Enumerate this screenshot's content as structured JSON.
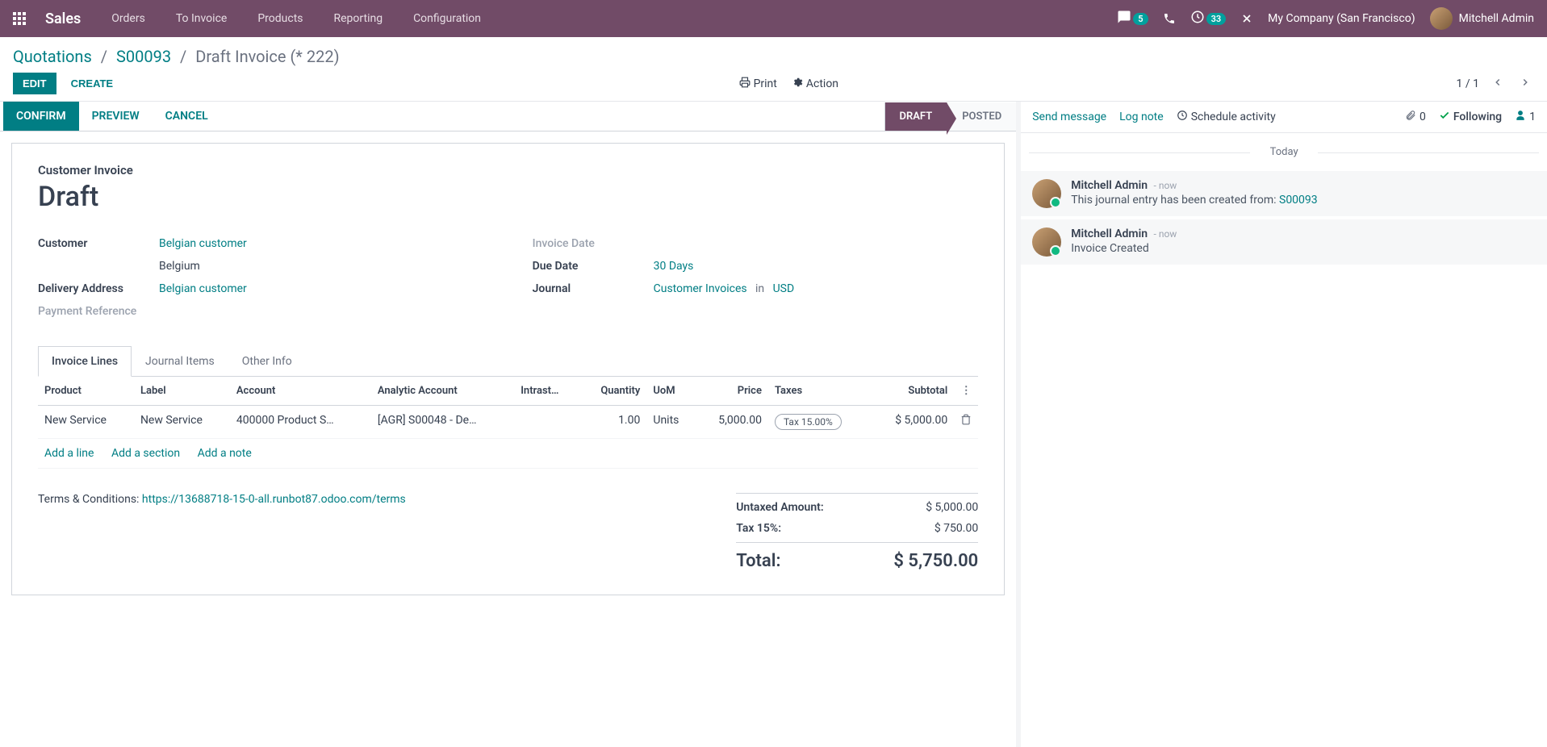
{
  "navbar": {
    "brand": "Sales",
    "menu": [
      "Orders",
      "To Invoice",
      "Products",
      "Reporting",
      "Configuration"
    ],
    "chat_count": "5",
    "clock_count": "33",
    "company": "My Company (San Francisco)",
    "user": "Mitchell Admin"
  },
  "breadcrumb": {
    "quotations": "Quotations",
    "order": "S00093",
    "current": "Draft Invoice (* 222)"
  },
  "control": {
    "edit": "EDIT",
    "create": "CREATE",
    "print": "Print",
    "action": "Action",
    "pager": "1 / 1"
  },
  "statusbar": {
    "confirm": "CONFIRM",
    "preview": "PREVIEW",
    "cancel": "CANCEL",
    "stage_draft": "DRAFT",
    "stage_posted": "POSTED"
  },
  "form": {
    "doc_type": "Customer Invoice",
    "title": "Draft",
    "fields": {
      "customer_label": "Customer",
      "customer_value": "Belgian customer",
      "customer_country": "Belgium",
      "delivery_label": "Delivery Address",
      "delivery_value": "Belgian customer",
      "payment_ref_label": "Payment Reference",
      "invoice_date_label": "Invoice Date",
      "due_date_label": "Due Date",
      "due_date_value": "30 Days",
      "journal_label": "Journal",
      "journal_value": "Customer Invoices",
      "journal_in": "in",
      "journal_currency": "USD"
    },
    "tabs": {
      "lines": "Invoice Lines",
      "journal": "Journal Items",
      "other": "Other Info"
    },
    "table": {
      "headers": {
        "product": "Product",
        "label": "Label",
        "account": "Account",
        "analytic": "Analytic Account",
        "intrastat": "Intrast…",
        "quantity": "Quantity",
        "uom": "UoM",
        "price": "Price",
        "taxes": "Taxes",
        "subtotal": "Subtotal"
      },
      "row": {
        "product": "New Service",
        "label": "New Service",
        "account": "400000 Product S…",
        "analytic": "[AGR] S00048 - De…",
        "quantity": "1.00",
        "uom": "Units",
        "price": "5,000.00",
        "taxes": "Tax 15.00%",
        "subtotal": "$ 5,000.00"
      },
      "add_line": "Add a line",
      "add_section": "Add a section",
      "add_note": "Add a note"
    },
    "terms_label": "Terms & Conditions: ",
    "terms_link": "https://13688718-15-0-all.runbot87.odoo.com/terms",
    "totals": {
      "untaxed_label": "Untaxed Amount:",
      "untaxed_value": "$ 5,000.00",
      "tax_label": "Tax 15%:",
      "tax_value": "$ 750.00",
      "total_label": "Total:",
      "total_value": "$ 5,750.00"
    }
  },
  "chatter": {
    "send": "Send message",
    "log": "Log note",
    "schedule": "Schedule activity",
    "attach_count": "0",
    "following": "Following",
    "followers_count": "1",
    "today": "Today",
    "messages": [
      {
        "author": "Mitchell Admin",
        "time": "- now",
        "text_prefix": "This journal entry has been created from: ",
        "text_link": "S00093"
      },
      {
        "author": "Mitchell Admin",
        "time": "- now",
        "text": "Invoice Created"
      }
    ]
  }
}
